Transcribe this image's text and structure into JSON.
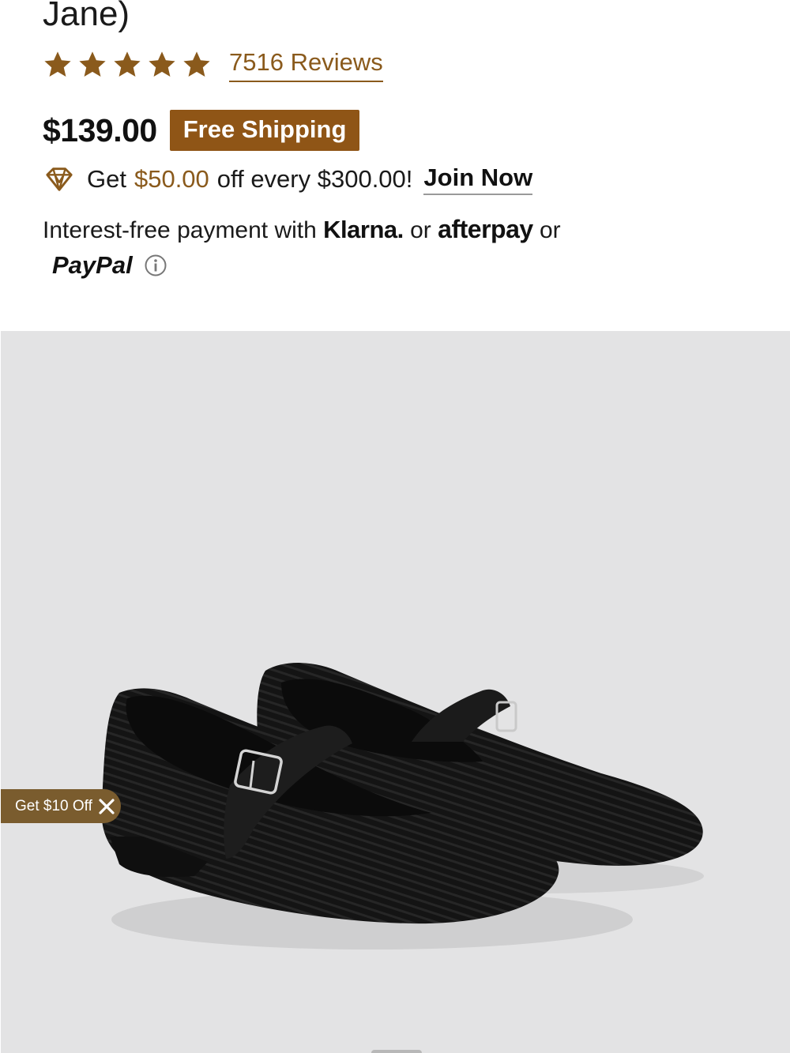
{
  "product": {
    "title_tail": "Jane)",
    "rating_stars": 5,
    "reviews_label": "7516 Reviews",
    "price": "$139.00",
    "shipping_badge": "Free Shipping"
  },
  "membership": {
    "icon": "diamond-icon",
    "prefix": "Get",
    "amount": "$50.00",
    "suffix": "off every $300.00!",
    "cta": "Join Now"
  },
  "payment": {
    "intro": "Interest-free payment with",
    "klarna": "Klarna.",
    "or1": "or",
    "afterpay": "afterpay",
    "or2": "or",
    "paypal": "PayPal",
    "info_icon": "info-icon"
  },
  "promo": {
    "label": "Get $10 Off",
    "close_icon": "close-icon"
  },
  "colors": {
    "accent": "#8a5a1c",
    "badge": "#8f5516",
    "hero_bg": "#e3e3e4",
    "promo_bg": "#7a5c2e"
  }
}
